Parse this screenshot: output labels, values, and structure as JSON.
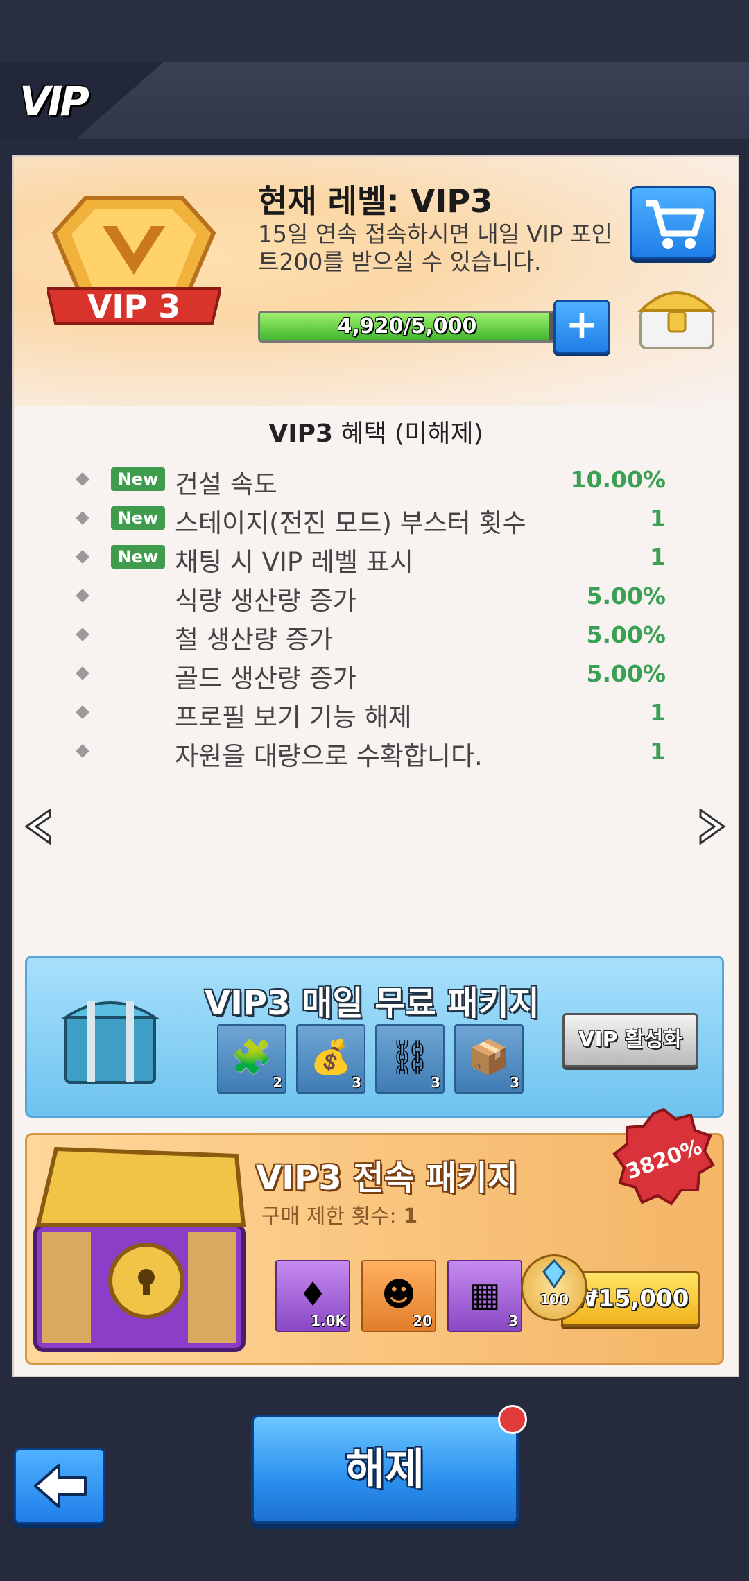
{
  "header": {
    "title": "VIP"
  },
  "vip": {
    "badge_label": "VIP 3",
    "current_level": "현재 레벨: VIP3",
    "description": "15일 연속 접속하시면 내일 VIP 포인트200를 받으실 수 있습니다.",
    "progress_text": "4,920/5,000",
    "progress_fraction": 0.984,
    "plus_label": "+"
  },
  "benefits": {
    "title_strong": "VIP3",
    "title_rest": "혜택 (미해제)",
    "items": [
      {
        "new": "New",
        "label": "건설 속도",
        "value": "10.00%"
      },
      {
        "new": "New",
        "label": "스테이지(전진 모드) 부스터 횟수",
        "value": "1"
      },
      {
        "new": "New",
        "label": "채팅 시 VIP 레벨 표시",
        "value": "1"
      },
      {
        "new": "",
        "label": "식량 생산량 증가",
        "value": "5.00%"
      },
      {
        "new": "",
        "label": "철 생산량 증가",
        "value": "5.00%"
      },
      {
        "new": "",
        "label": "골드 생산량 증가",
        "value": "5.00%"
      },
      {
        "new": "",
        "label": "프로필 보기 기능 해제",
        "value": "1"
      },
      {
        "new": "",
        "label": "자원을 대량으로 수확합니다.",
        "value": "1"
      }
    ]
  },
  "daily_package": {
    "title": "VIP3 매일 무료 패키지",
    "button": "VIP 활성화",
    "items": [
      {
        "icon": "puzzle-piece-icon",
        "count": "2"
      },
      {
        "icon": "gold-pile-icon",
        "count": "3"
      },
      {
        "icon": "iron-pile-icon",
        "count": "3"
      },
      {
        "icon": "gold-crate-icon",
        "count": "3"
      }
    ]
  },
  "exclusive_package": {
    "title": "VIP3 전속 패키지",
    "limit_label": "구매 제한 횟수:",
    "limit_value": "1",
    "discount": "3820%",
    "items": [
      {
        "icon": "ruby-icon",
        "count": "1.0K"
      },
      {
        "icon": "hero-shard-icon",
        "count": "20"
      },
      {
        "icon": "iron-crate-icon",
        "count": "3"
      }
    ],
    "vip_points": "100",
    "price": "₩15,000"
  },
  "footer": {
    "unlock_button": "해제"
  },
  "colors": {
    "accent_blue": "#2b90ef",
    "value_green": "#3aa053",
    "new_badge": "#3e9c4c",
    "gold": "#f2b21a"
  }
}
